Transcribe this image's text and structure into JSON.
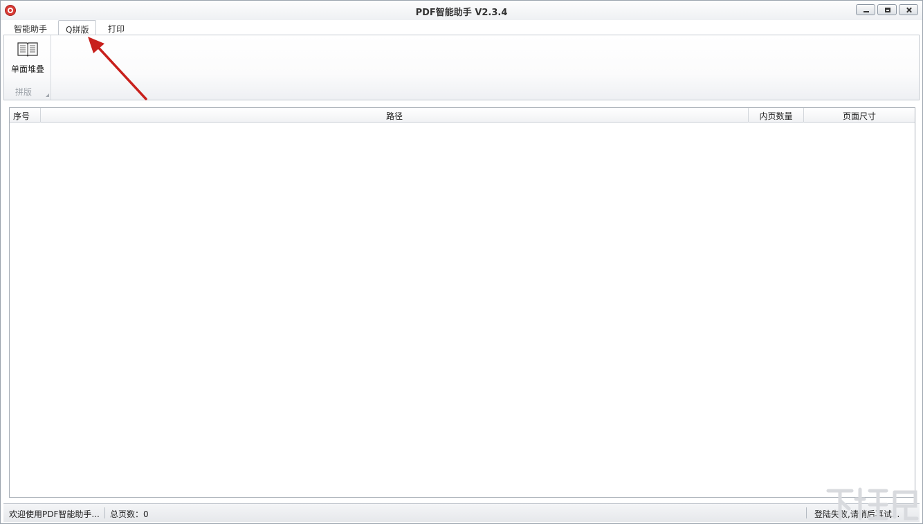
{
  "window": {
    "title": "PDF智能助手 V2.3.4"
  },
  "tabs": [
    {
      "label": "智能助手",
      "active": false
    },
    {
      "label": "Q拼版",
      "active": true
    },
    {
      "label": "打印",
      "active": false
    }
  ],
  "ribbon": {
    "group_label": "拼版",
    "buttons": [
      {
        "label": "单面堆叠",
        "icon": "book-icon"
      }
    ]
  },
  "table": {
    "columns": [
      "序号",
      "路径",
      "内页数量",
      "页面尺寸"
    ],
    "rows": []
  },
  "status": {
    "welcome": "欢迎使用PDF智能助手...",
    "total_pages_label": "总页数：0",
    "login_status": "登陆失败,请稍后再试..."
  },
  "colors": {
    "accent_arrow": "#c8201c",
    "app_icon": "#d83a34"
  }
}
